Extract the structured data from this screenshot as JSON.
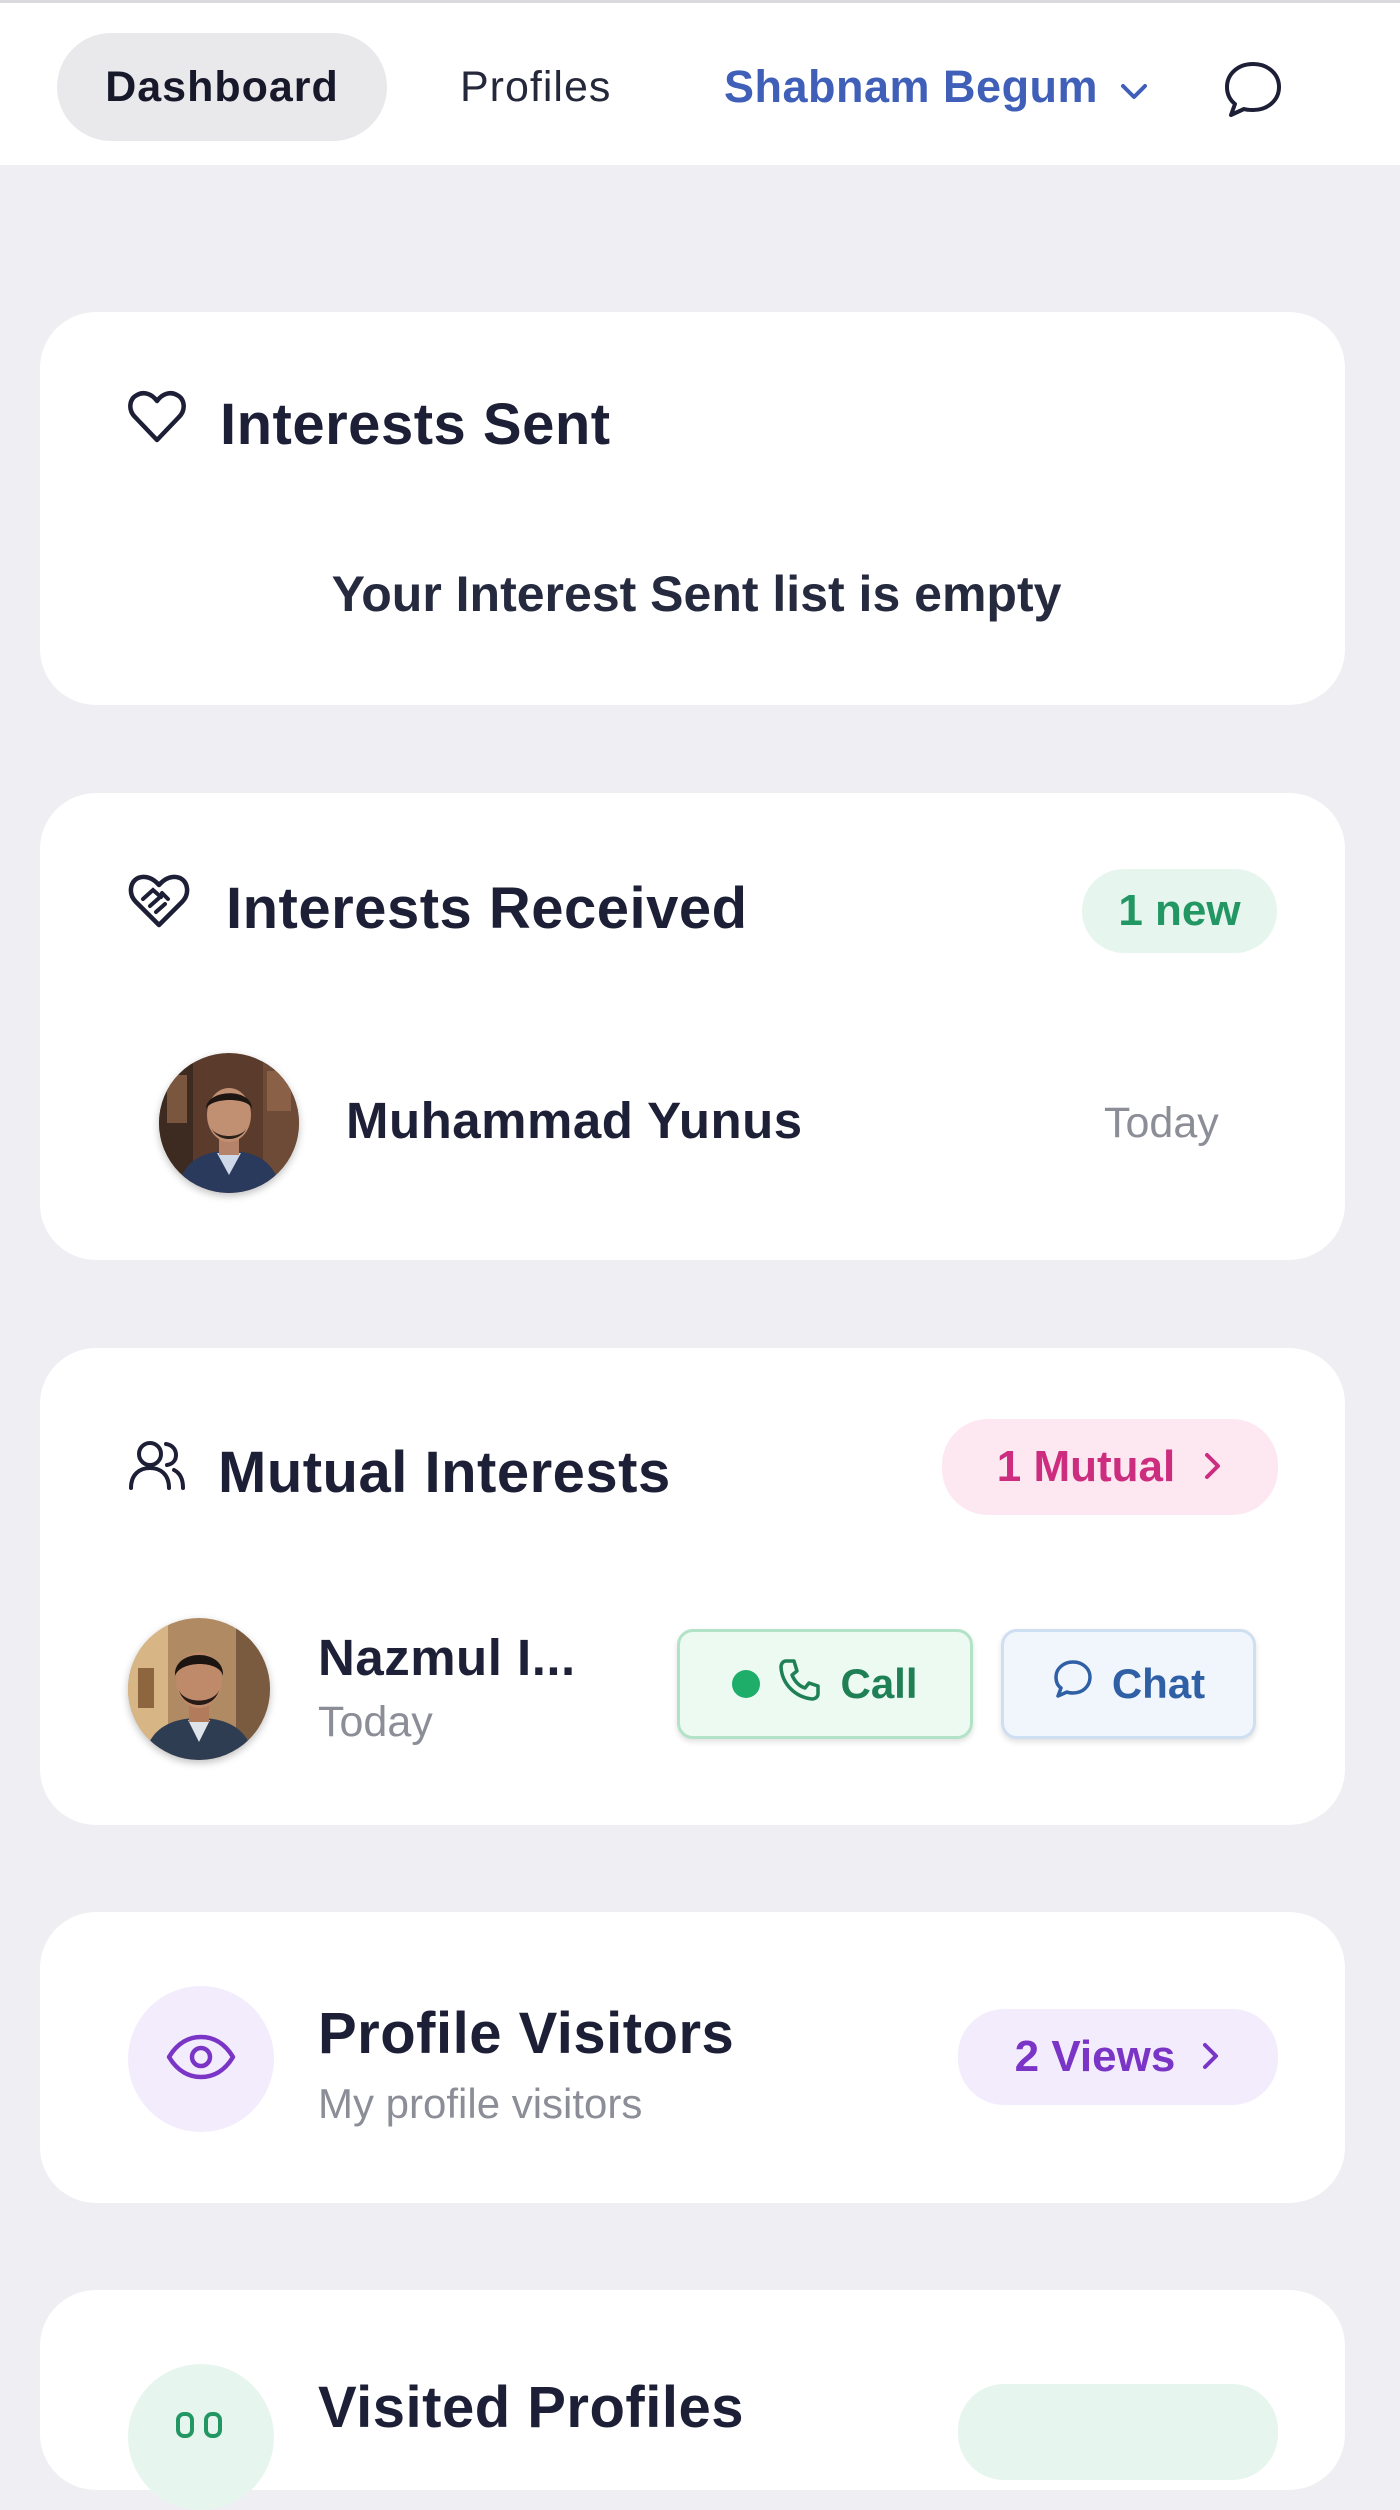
{
  "nav": {
    "dashboard": "Dashboard",
    "profiles": "Profiles",
    "user_name": "Shabnam Begum",
    "user_icon": "chevron-down-icon",
    "chat_icon": "chat-bubble-icon"
  },
  "interests_sent": {
    "title": "Interests Sent",
    "icon": "heart-icon",
    "empty_text": "Your Interest Sent list is empty"
  },
  "interests_received": {
    "title": "Interests Received",
    "icon": "handshake-heart-icon",
    "badge": "1 new",
    "items": [
      {
        "name": "Muhammad Yunus",
        "time": "Today"
      }
    ]
  },
  "mutual_interests": {
    "title": "Mutual Interests",
    "icon": "users-icon",
    "badge": "1 Mutual",
    "items": [
      {
        "name": "Nazmul I...",
        "time": "Today",
        "call_label": "Call",
        "chat_label": "Chat",
        "online": true
      }
    ]
  },
  "profile_visitors": {
    "title": "Profile Visitors",
    "subtitle": "My profile visitors",
    "icon": "eye-icon",
    "badge": "2 Views"
  },
  "visited_profiles": {
    "title": "Visited Profiles"
  },
  "colors": {
    "accent_blue": "#3f5fb8",
    "green_badge_bg": "#e6f6ee",
    "green_text": "#239763",
    "pink_badge_bg": "#fde8f2",
    "pink_text": "#cc2d7f",
    "purple_bg": "#f3ecfd",
    "purple_text": "#7b35c6"
  }
}
